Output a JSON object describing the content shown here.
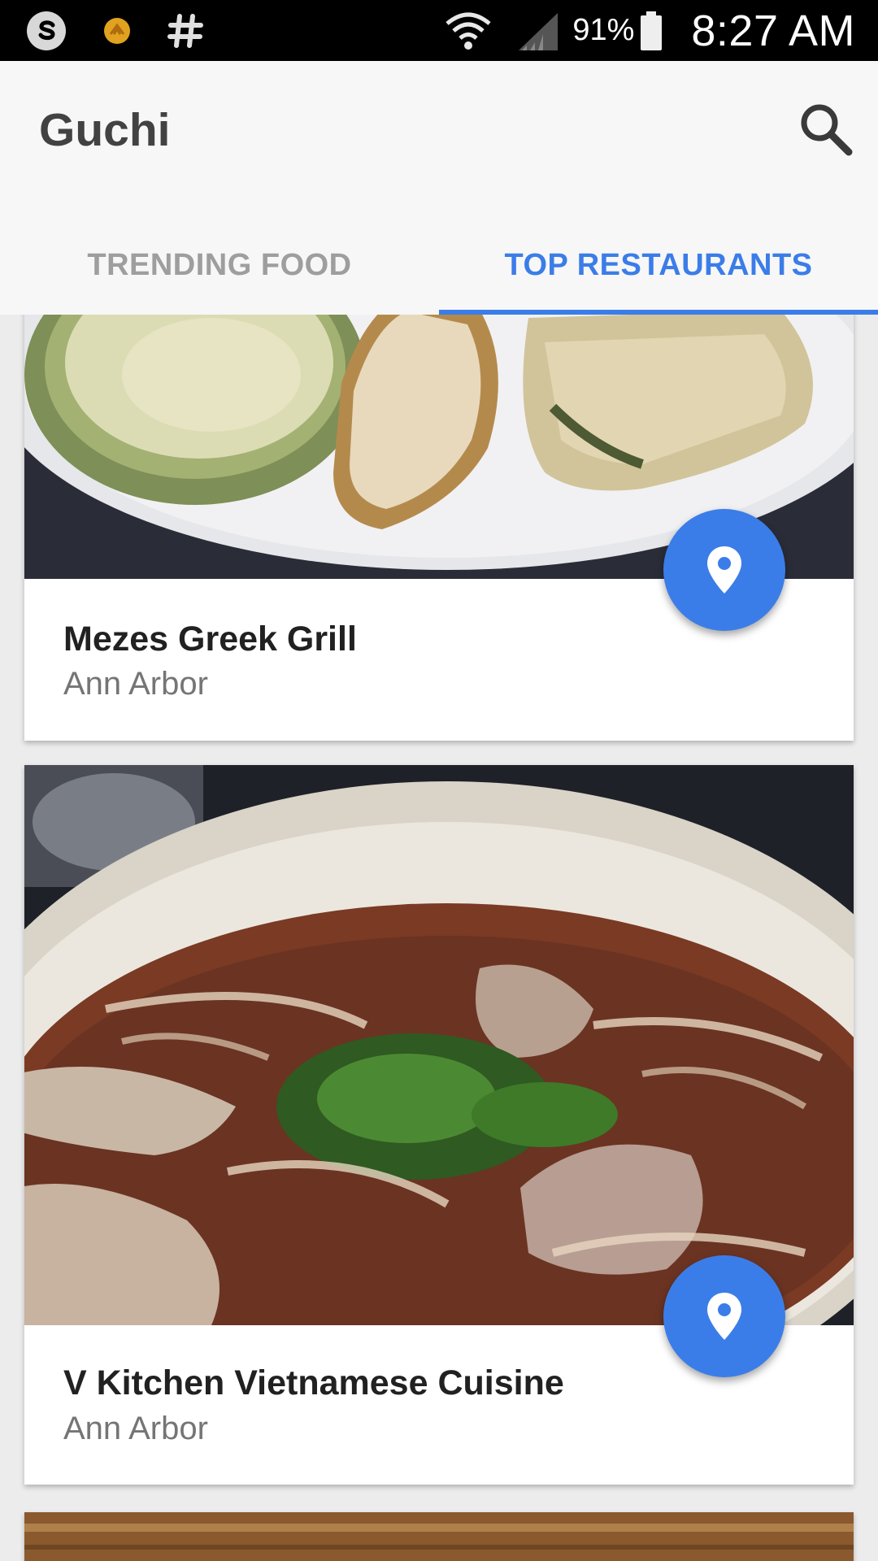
{
  "status_bar": {
    "icons_left": [
      "skype-icon",
      "notification-app-icon",
      "hashtag-icon"
    ],
    "icons_right": [
      "wifi-icon",
      "signal-icon",
      "battery-icon"
    ],
    "battery": "91%",
    "time": "8:27 AM"
  },
  "app_bar": {
    "title": "Guchi",
    "search_icon": "search-icon"
  },
  "tabs": [
    {
      "label": "TRENDING FOOD",
      "active": false
    },
    {
      "label": "TOP RESTAURANTS",
      "active": true
    }
  ],
  "colors": {
    "accent": "#3b7de8",
    "appbar_bg": "#f7f7f7",
    "title_text": "#424242",
    "inactive_tab": "#9e9e9e"
  },
  "restaurants": [
    {
      "name": "Mezes Greek Grill",
      "location": "Ann Arbor",
      "photo": "soup-bread-spanakopita-photo",
      "action_icon": "location-pin-icon"
    },
    {
      "name": "V Kitchen Vietnamese Cuisine",
      "location": "Ann Arbor",
      "photo": "pho-noodle-soup-photo",
      "action_icon": "location-pin-icon"
    }
  ]
}
